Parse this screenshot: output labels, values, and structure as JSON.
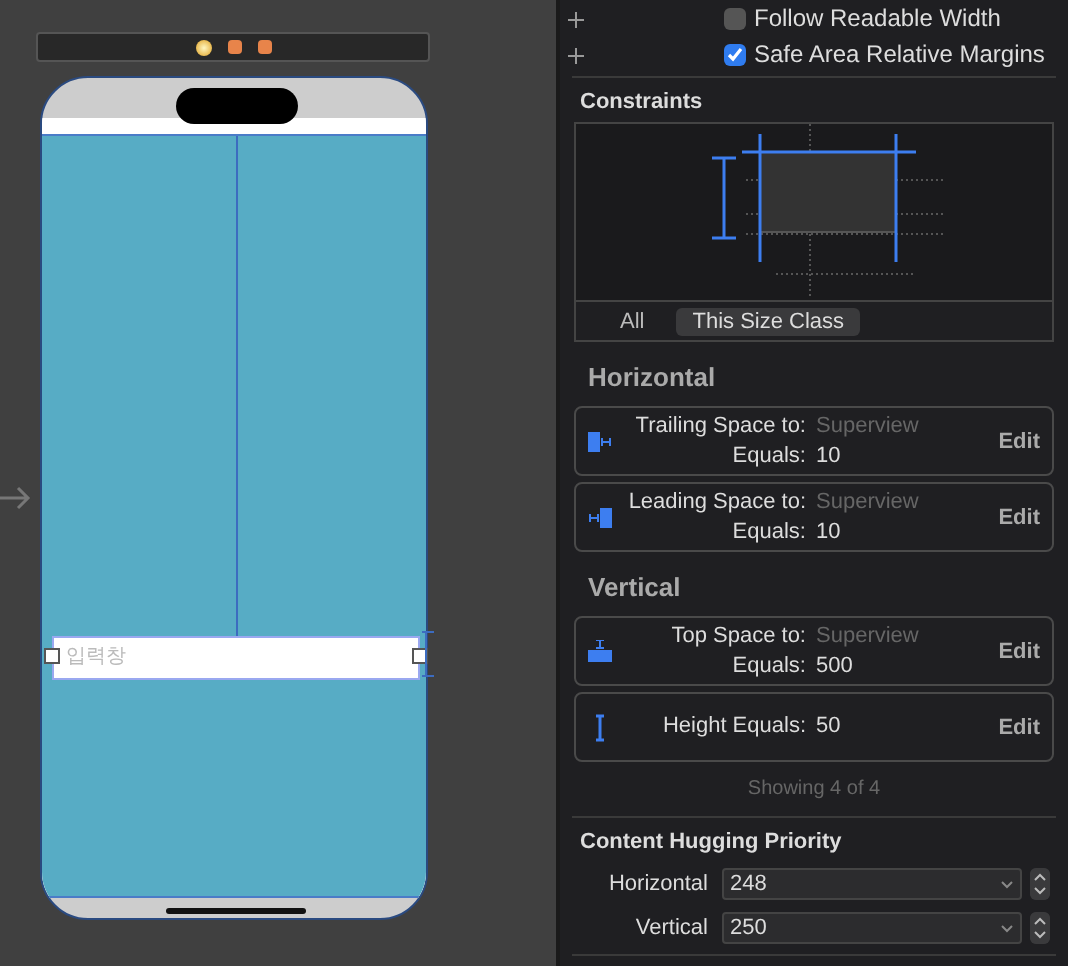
{
  "canvas": {
    "field_placeholder": "입력창"
  },
  "options": [
    {
      "label": "Follow Readable Width",
      "checked": false
    },
    {
      "label": "Safe Area Relative Margins",
      "checked": true
    }
  ],
  "constraints": {
    "title": "Constraints",
    "filters": [
      {
        "label": "All",
        "selected": false
      },
      {
        "label": "This Size Class",
        "selected": true
      }
    ]
  },
  "groups": [
    {
      "title": "Horizontal",
      "items": [
        {
          "kind": "trailing",
          "label": "Trailing Space to:",
          "target": "Superview",
          "equals_label": "Equals:",
          "value": "10",
          "action": "Edit"
        },
        {
          "kind": "leading",
          "label": "Leading Space to:",
          "target": "Superview",
          "equals_label": "Equals:",
          "value": "10",
          "action": "Edit"
        }
      ]
    },
    {
      "title": "Vertical",
      "items": [
        {
          "kind": "top",
          "label": "Top Space to:",
          "target": "Superview",
          "equals_label": "Equals:",
          "value": "500",
          "action": "Edit"
        },
        {
          "kind": "height",
          "label": "Height Equals:",
          "value": "50",
          "action": "Edit"
        }
      ]
    }
  ],
  "footer": "Showing 4 of 4",
  "hugging": {
    "title": "Content Hugging Priority",
    "rows": [
      {
        "label": "Horizontal",
        "value": "248"
      },
      {
        "label": "Vertical",
        "value": "250"
      }
    ]
  }
}
